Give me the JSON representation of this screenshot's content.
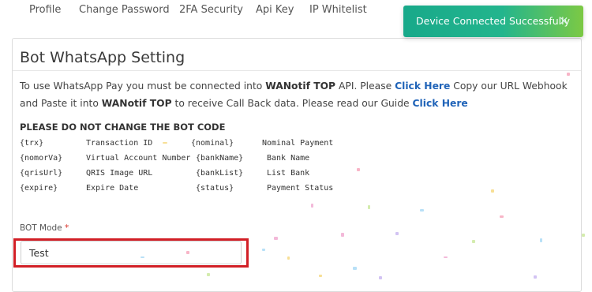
{
  "tabs": [
    {
      "label": "Profile"
    },
    {
      "label": "Change Password"
    },
    {
      "label": "2FA Security"
    },
    {
      "label": "Api Key"
    },
    {
      "label": "IP Whitelist"
    }
  ],
  "toast": {
    "text": "Device Connected Successfully",
    "close": "×"
  },
  "card": {
    "title": "Bot WhatsApp Setting",
    "intro": {
      "p1": "To use WhatsApp Pay you must be connected into ",
      "brand": "WANotif TOP",
      "p2": " API. Please ",
      "link1": "Click Here",
      "p3": " Copy our URL Webhook and Paste it into ",
      "p4": " to receive Call Back data. Please read our Guide ",
      "link2": "Click Here"
    },
    "warning": "PLEASE DO NOT CHANGE THE BOT CODE",
    "codes": [
      {
        "code": "{trx}",
        "desc": "Transaction ID"
      },
      {
        "code": "{nomorVa}",
        "desc": "Virtual Account Number"
      },
      {
        "code": "{qrisUrl}",
        "desc": "QRIS Image URL"
      },
      {
        "code": "{expire}",
        "desc": "Expire Date"
      },
      {
        "code": "{nominal}",
        "desc": "Nominal Payment"
      },
      {
        "code": "{bankName}",
        "desc": "Bank Name"
      },
      {
        "code": "{bankList}",
        "desc": "List Bank"
      },
      {
        "code": "{status}",
        "desc": "Payment Status"
      }
    ],
    "bot_mode": {
      "label": "BOT Mode",
      "required": "*",
      "value": "Test"
    }
  },
  "colors": {
    "link": "#1f63b8",
    "toast": "#23b58d",
    "highlight": "#d21f26",
    "required": "#d9342b"
  }
}
